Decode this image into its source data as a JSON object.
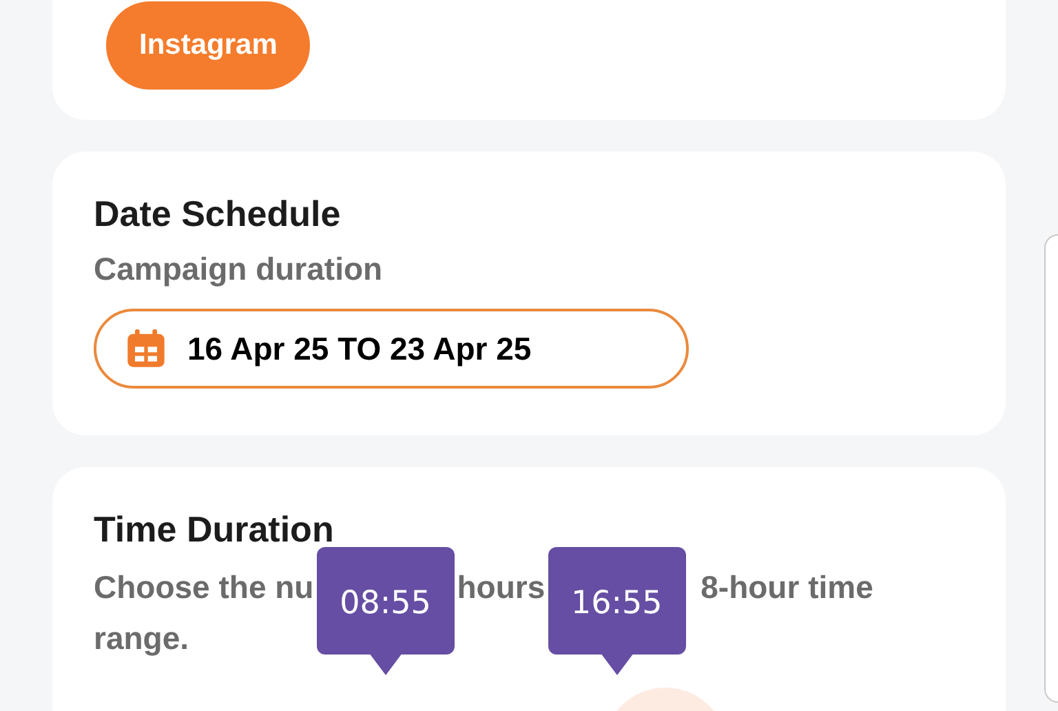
{
  "platform_card": {
    "buttons": [
      {
        "label": "Instagram"
      }
    ]
  },
  "date_schedule": {
    "title": "Date Schedule",
    "subtitle": "Campaign duration",
    "date_range": "16 Apr 25 TO 23 Apr 25"
  },
  "time_duration": {
    "title": "Time Duration",
    "description_fragments": [
      "Choose the nu",
      "hours",
      "8-hour time"
    ],
    "description_line_2": "range.",
    "tooltips": [
      "08:55",
      "16:55"
    ]
  }
}
